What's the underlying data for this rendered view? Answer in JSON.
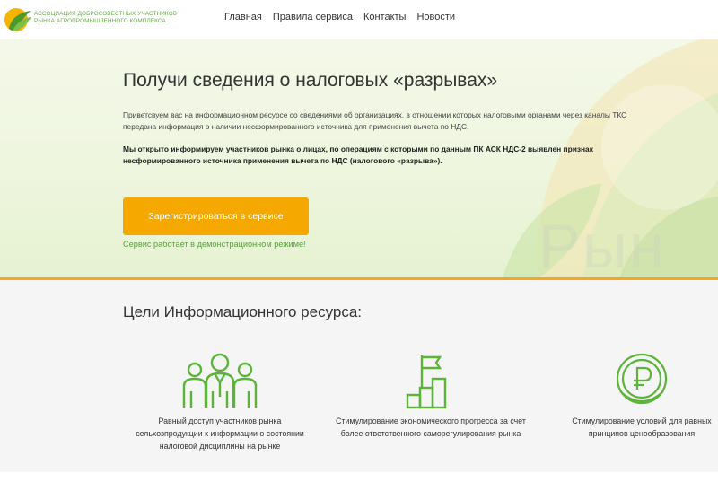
{
  "header": {
    "logo_text_line1": "Ассоциация добросовестных участников",
    "logo_text_line2": "рынка агропромышленного комплекса",
    "nav": [
      "Главная",
      "Правила сервиса",
      "Контакты",
      "Новости"
    ]
  },
  "hero": {
    "title": "Получи сведения о налоговых «разрывах»",
    "description": "Приветсвуем вас на информационном ресурсе со сведениями об организациях, в отношении которых налоговыми органами через каналы ТКС передана информация о наличии несформированного источника для применения вычета по НДС.",
    "notice": "Мы открыто информируем участников рынка о лицах, по операциям с которыми по данным ПК АСК НДС-2 выявлен признак несформированного источника применения вычета по НДС (налогового «разрыва»).",
    "register_label": "Зарегистрироваться в сервисе",
    "demo_note": "Сервис работает в демонстрационном режиме!",
    "watermark": "Рын"
  },
  "goals": {
    "title": "Цели Информационного ресурса:",
    "items": [
      {
        "icon": "people-group-icon",
        "text": "Равный доступ участников рынка сельхозпродукции к информации о состоянии налоговой дисциплины на рынке"
      },
      {
        "icon": "growth-stairs-flag-icon",
        "text": "Стимулирование экономического прогресса за счет более ответственного саморегулирования рынка"
      },
      {
        "icon": "ruble-coin-icon",
        "text": "Стимулирование условий для равных принципов ценообразования"
      }
    ]
  },
  "colors": {
    "accent_orange": "#f5a800",
    "brand_green": "#5a9e3e",
    "hero_bg": "#eef6de"
  }
}
